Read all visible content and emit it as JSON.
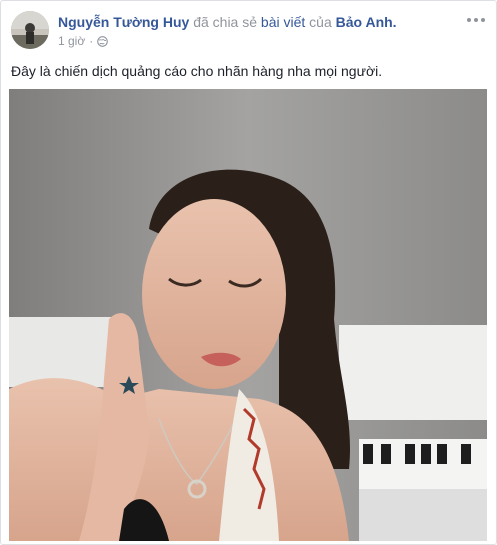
{
  "post": {
    "author_name": "Nguyễn Tường Huy",
    "action_text": "đã chia sẻ",
    "shared_object": "bài viết",
    "of_text": "của",
    "original_author": "Bảo Anh.",
    "timestamp": "1 giờ",
    "separator": "·",
    "privacy_icon": "globe-icon",
    "menu_icon": "more-options-icon",
    "body_text": "Đây là chiến dịch quảng cáo cho nhãn hàng nha mọi người.",
    "photo_icon": "shared-photo"
  },
  "colors": {
    "link": "#365899",
    "meta": "#90949c",
    "text": "#1d2129"
  }
}
